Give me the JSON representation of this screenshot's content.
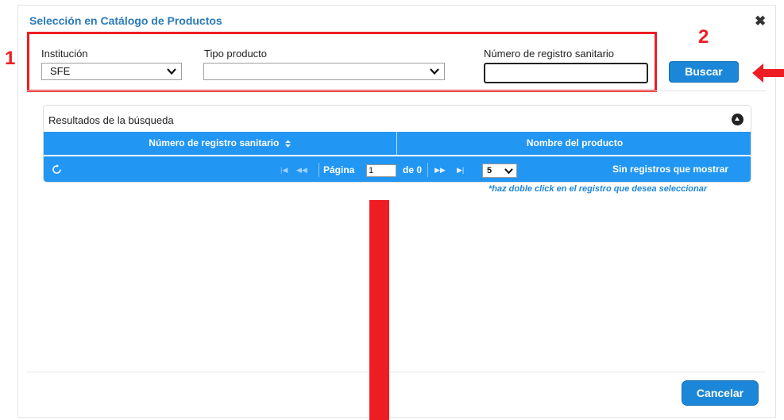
{
  "dialog": {
    "title": "Selección en Catálogo de Productos",
    "close_icon": "close-icon"
  },
  "filters": {
    "institucion_label": "Institución",
    "institucion_value": "SFE",
    "tipo_producto_label": "Tipo producto",
    "tipo_producto_value": "",
    "registro_label": "Número de registro sanitario",
    "registro_value": ""
  },
  "annotations": {
    "step1": "1",
    "step2": "2",
    "color": "#ee1d23"
  },
  "buttons": {
    "buscar": "Buscar",
    "cancelar": "Cancelar"
  },
  "results": {
    "title": "Resultados de la búsqueda",
    "columns": [
      "Número de registro sanitario",
      "Nombre del producto"
    ],
    "rows": [],
    "pager": {
      "page_label": "Página",
      "page_value": "1",
      "of_label": "de 0",
      "page_size": "5",
      "empty_message": "Sin registros que mostrar"
    },
    "hint": "*haz doble click en el registro que desea seleccionar"
  },
  "colors": {
    "header_blue": "#2196f3",
    "button_blue": "#1c87d8",
    "title_blue": "#2a7ab8",
    "annotation_red": "#ee1d23"
  }
}
